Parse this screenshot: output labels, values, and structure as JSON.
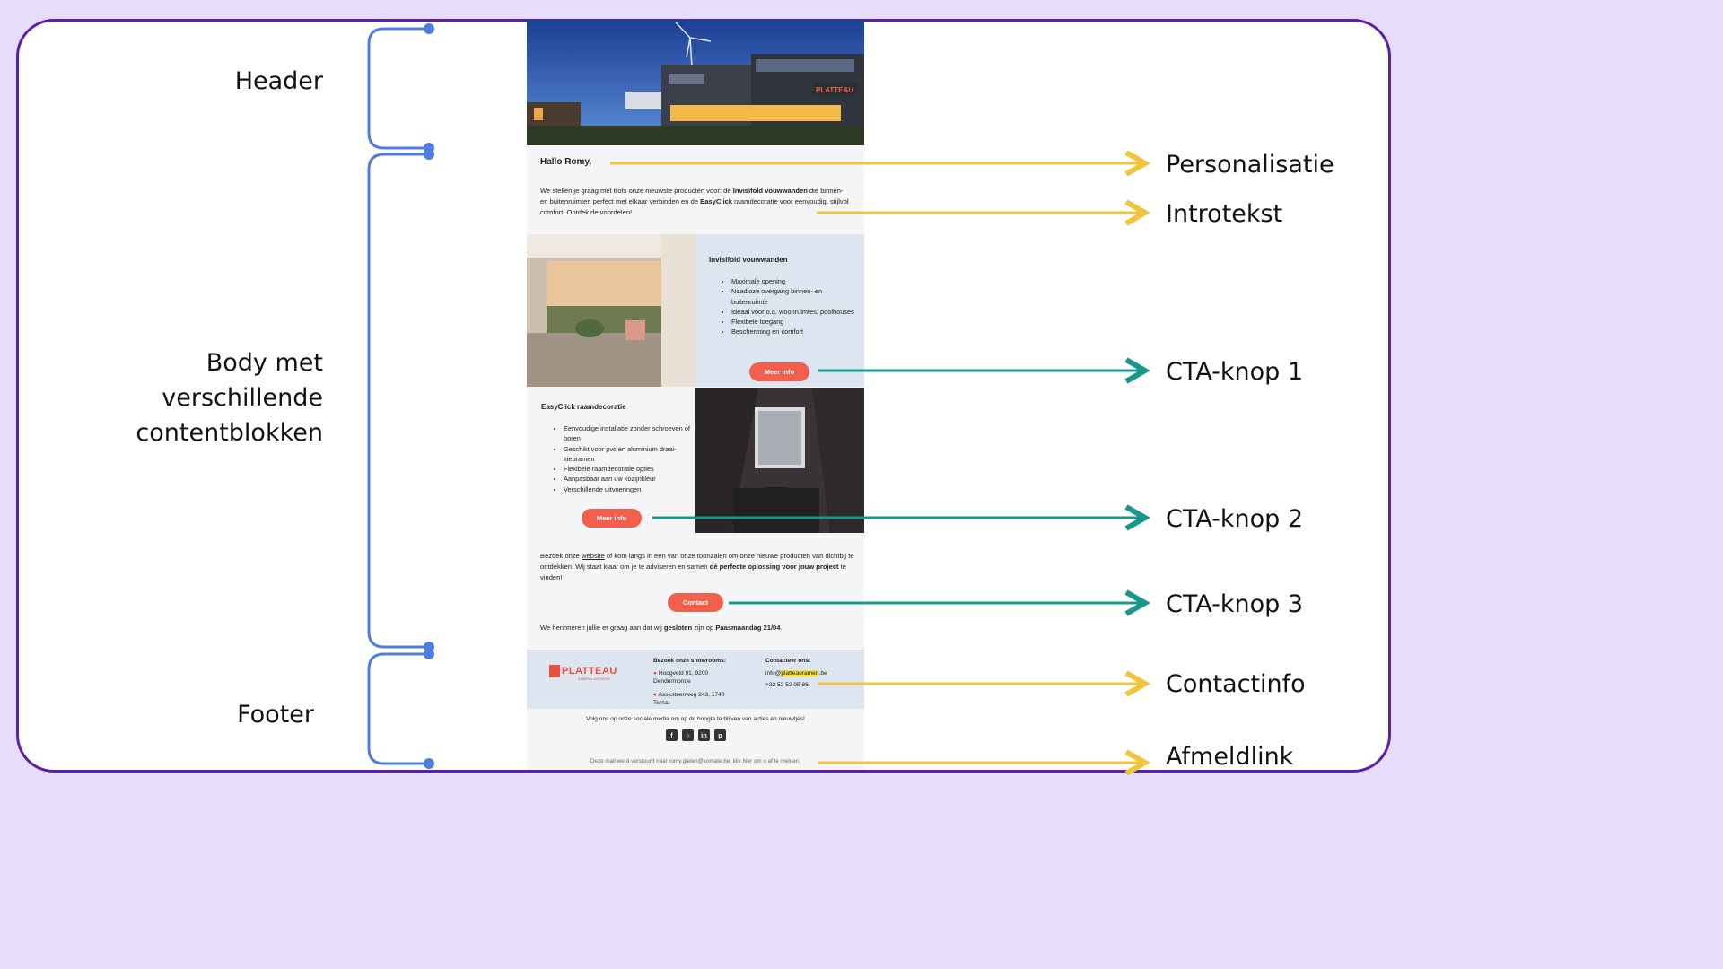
{
  "left_labels": {
    "header": "Header",
    "body_line1": "Body met",
    "body_line2": "verschillende",
    "body_line3": "contentblokken",
    "footer": "Footer"
  },
  "right_labels": {
    "personalisatie": "Personalisatie",
    "introtekst": "Introtekst",
    "cta1": "CTA-knop 1",
    "cta2": "CTA-knop 2",
    "cta3": "CTA-knop 3",
    "contactinfo": "Contactinfo",
    "afmeldlink": "Afmeldlink"
  },
  "colors": {
    "background": "#e6dcfb",
    "frame": "#5b1fa8",
    "bracket": "#4f7de0",
    "arrow_yellow": "#f0c53c",
    "arrow_teal": "#16998c",
    "button": "#f0604c"
  },
  "email": {
    "hero_logo": "PLATTEAU",
    "greeting": "Hallo Romy,",
    "intro_part1": "We stellen je graag met trots onze nieuwste producten voor: de ",
    "intro_bold1": "Invisifold vouwwanden",
    "intro_part2": " die binnen- en buitenruimten perfect met elkaar verbinden en de ",
    "intro_bold2": "EasyClick",
    "intro_part3": " raamdecoratie voor eenvoudig, stijlvol comfort. Ontdek de voordelen!",
    "block1": {
      "title": "Invisifold vouwwanden",
      "items": [
        "Maximale opening",
        "Naadloze overgang binnen- en buitenruimte",
        "Ideaal voor o.a. woonruimtes, poolhouses",
        "Flexibele toegang",
        "Bescherming en comfort"
      ],
      "button": "Meer info"
    },
    "block2": {
      "title": "EasyClick raamdecoratie",
      "items": [
        "Eenvoudige installatie zonder schroeven of boren",
        "Geschikt voor pvc en aluminium draai-kiepramen",
        "Flexibele raamdecoratie opties",
        "Aanpasbaar aan uw kozijnkleur",
        "Verschillende uitvoeringen"
      ],
      "button": "Meer info"
    },
    "visit_part1": "Bezoek onze ",
    "visit_link": "website",
    "visit_part2": " of kom langs in een van onze toonzalen om onze nieuwe producten van dichtbij te ontdekken. Wij staat klaar om je te adviseren en samen ",
    "visit_bold": "dé perfecte oplossing voor jouw project",
    "visit_part3": " te vinden!",
    "contact_button": "Contact",
    "remind_part1": "We herinneren jullie er graag aan dat wij ",
    "remind_bold1": "gesloten",
    "remind_part2": " zijn op ",
    "remind_bold2": "Paasmaandag 21/04",
    "remind_part3": ".",
    "footer": {
      "logo": "PLATTEAU",
      "logo_sub": "RAMEN & OUTDOOR",
      "showrooms_title": "Bezoek onze showrooms:",
      "showroom1_line1": "Hoogveld 91, 9200",
      "showroom1_line2": "Dendermonde",
      "showroom2_line1": "Assesteenweg 243, 1740",
      "showroom2_line2": "Ternat",
      "contact_title": "Contacteer ons:",
      "email_pre": "info@",
      "email_hl": "platteauramen",
      "email_post": ".be",
      "phone": "+32 52 52 05 86"
    },
    "social_text": "Volg ons op onze sociale media om op de hoogte te blijven van acties en nieuwtjes!",
    "socials": [
      "facebook-icon",
      "instagram-icon",
      "linkedin-icon",
      "pinterest-icon"
    ],
    "unsubscribe": "Deze mail werd verstuurd naar romy.gielen@komate.be, klik hier om u af te melden."
  }
}
